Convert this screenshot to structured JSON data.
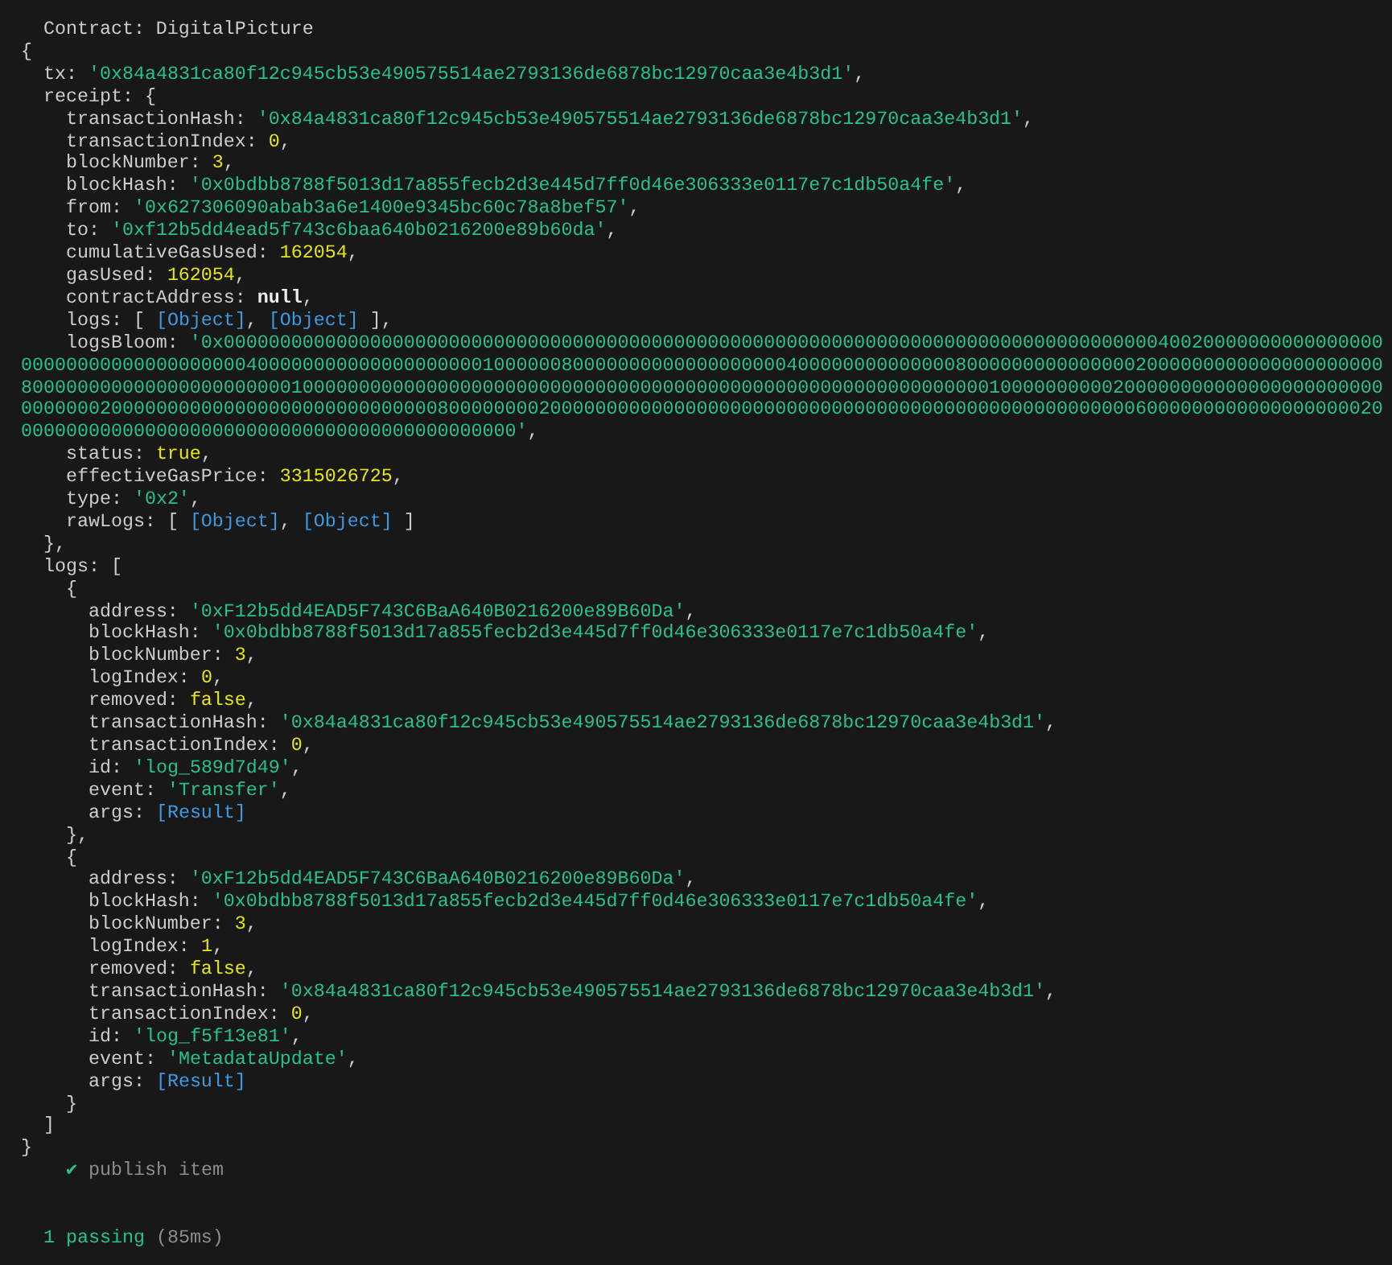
{
  "title": "Contract: DigitalPicture",
  "root": {
    "kind": "object",
    "open": "{",
    "close": "}",
    "children": [
      {
        "key": "tx:",
        "kind": "string",
        "value": "'0x84a4831ca80f12c945cb53e490575514ae2793136de6878bc12970caa3e4b3d1'",
        "end": ","
      },
      {
        "key": "receipt:",
        "kind": "object",
        "open": "{",
        "close": "},",
        "children": [
          {
            "key": "transactionHash:",
            "kind": "string",
            "value": "'0x84a4831ca80f12c945cb53e490575514ae2793136de6878bc12970caa3e4b3d1'",
            "end": ","
          },
          {
            "key": "transactionIndex:",
            "kind": "number",
            "value": "0",
            "end": ","
          },
          {
            "key": "blockNumber:",
            "kind": "number",
            "value": "3",
            "end": ","
          },
          {
            "key": "blockHash:",
            "kind": "string",
            "value": "'0x0bdbb8788f5013d17a855fecb2d3e445d7ff0d46e306333e0117e7c1db50a4fe'",
            "end": ","
          },
          {
            "key": "from:",
            "kind": "string",
            "value": "'0x627306090abab3a6e1400e9345bc60c78a8bef57'",
            "end": ","
          },
          {
            "key": "to:",
            "kind": "string",
            "value": "'0xf12b5dd4ead5f743c6baa640b0216200e89b60da'",
            "end": ","
          },
          {
            "key": "cumulativeGasUsed:",
            "kind": "number",
            "value": "162054",
            "end": ","
          },
          {
            "key": "gasUsed:",
            "kind": "number",
            "value": "162054",
            "end": ","
          },
          {
            "key": "contractAddress:",
            "kind": "null",
            "value": "null",
            "end": ","
          },
          {
            "key": "logs:",
            "kind": "inline",
            "open": "[",
            "close": "],",
            "items": [
              {
                "kind": "ref",
                "value": "[Object]",
                "end": ","
              },
              {
                "kind": "ref",
                "value": "[Object]"
              }
            ]
          },
          {
            "key": "logsBloom:",
            "kind": "string",
            "value": "'0x000000000000000000000000000000000000000000000000000000000000000000000000000000000004002000000000000000000000000000000000000400000000000000000000100000080000000000000000000400000000000000800000000000000020000000000000000000008000000000000000000000001000000000000000000000000000000000000000000000000000000000000010000000000200000000000000000000000000000020000000000000000000000000000080000000020000000000000000000000000000000000000000000000000000600000000000000000002000000000000000000000000000000000000000000000'",
            "end": ","
          },
          {
            "key": "status:",
            "kind": "boolean",
            "value": "true",
            "end": ","
          },
          {
            "key": "effectiveGasPrice:",
            "kind": "number",
            "value": "3315026725",
            "end": ","
          },
          {
            "key": "type:",
            "kind": "string",
            "value": "'0x2'",
            "end": ","
          },
          {
            "key": "rawLogs:",
            "kind": "inline",
            "open": "[",
            "close": "]",
            "items": [
              {
                "kind": "ref",
                "value": "[Object]",
                "end": ","
              },
              {
                "kind": "ref",
                "value": "[Object]"
              }
            ]
          }
        ]
      },
      {
        "key": "logs:",
        "kind": "object",
        "open": "[",
        "close": "]",
        "children": [
          {
            "kind": "object",
            "open": "{",
            "close": "},",
            "children": [
              {
                "key": "address:",
                "kind": "string",
                "value": "'0xF12b5dd4EAD5F743C6BaA640B0216200e89B60Da'",
                "end": ","
              },
              {
                "key": "blockHash:",
                "kind": "string",
                "value": "'0x0bdbb8788f5013d17a855fecb2d3e445d7ff0d46e306333e0117e7c1db50a4fe'",
                "end": ","
              },
              {
                "key": "blockNumber:",
                "kind": "number",
                "value": "3",
                "end": ","
              },
              {
                "key": "logIndex:",
                "kind": "number",
                "value": "0",
                "end": ","
              },
              {
                "key": "removed:",
                "kind": "boolean",
                "value": "false",
                "end": ","
              },
              {
                "key": "transactionHash:",
                "kind": "string",
                "value": "'0x84a4831ca80f12c945cb53e490575514ae2793136de6878bc12970caa3e4b3d1'",
                "end": ","
              },
              {
                "key": "transactionIndex:",
                "kind": "number",
                "value": "0",
                "end": ","
              },
              {
                "key": "id:",
                "kind": "string",
                "value": "'log_589d7d49'",
                "end": ","
              },
              {
                "key": "event:",
                "kind": "string",
                "value": "'Transfer'",
                "end": ","
              },
              {
                "key": "args:",
                "kind": "ref",
                "value": "[Result]"
              }
            ]
          },
          {
            "kind": "object",
            "open": "{",
            "close": "}",
            "children": [
              {
                "key": "address:",
                "kind": "string",
                "value": "'0xF12b5dd4EAD5F743C6BaA640B0216200e89B60Da'",
                "end": ","
              },
              {
                "key": "blockHash:",
                "kind": "string",
                "value": "'0x0bdbb8788f5013d17a855fecb2d3e445d7ff0d46e306333e0117e7c1db50a4fe'",
                "end": ","
              },
              {
                "key": "blockNumber:",
                "kind": "number",
                "value": "3",
                "end": ","
              },
              {
                "key": "logIndex:",
                "kind": "number",
                "value": "1",
                "end": ","
              },
              {
                "key": "removed:",
                "kind": "boolean",
                "value": "false",
                "end": ","
              },
              {
                "key": "transactionHash:",
                "kind": "string",
                "value": "'0x84a4831ca80f12c945cb53e490575514ae2793136de6878bc12970caa3e4b3d1'",
                "end": ","
              },
              {
                "key": "transactionIndex:",
                "kind": "number",
                "value": "0",
                "end": ","
              },
              {
                "key": "id:",
                "kind": "string",
                "value": "'log_f5f13e81'",
                "end": ","
              },
              {
                "key": "event:",
                "kind": "string",
                "value": "'MetadataUpdate'",
                "end": ","
              },
              {
                "key": "args:",
                "kind": "ref",
                "value": "[Result]"
              }
            ]
          }
        ]
      }
    ]
  },
  "test": {
    "mark": "✔",
    "name": "publish item",
    "passed": true
  },
  "summary": {
    "count": "1 passing",
    "duration": "(85ms)"
  }
}
